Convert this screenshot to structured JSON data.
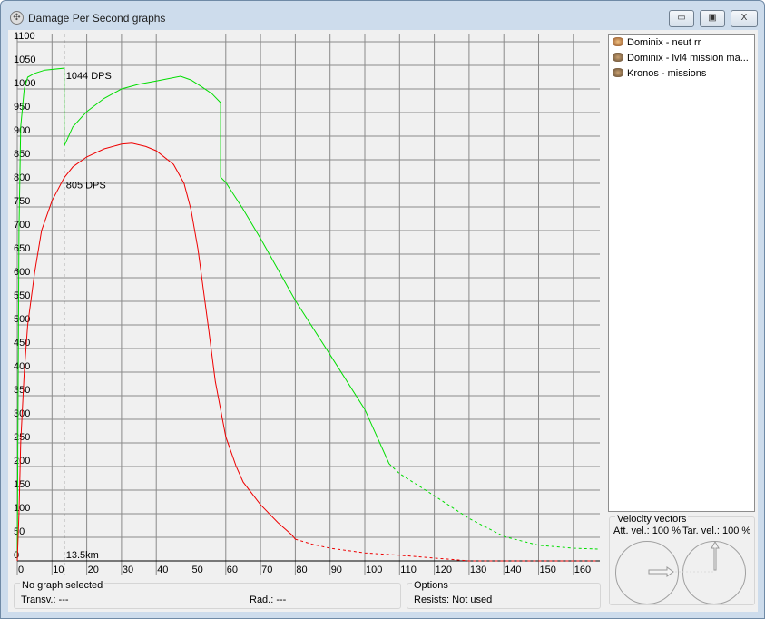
{
  "window": {
    "title": "Damage Per Second graphs",
    "buttons": {
      "minimize": "▭",
      "maximize": "▣",
      "close": "X"
    }
  },
  "legend": {
    "items": [
      {
        "label": "Dominix - neut rr",
        "color": "#ff0000"
      },
      {
        "label": "Dominix - lvl4 mission ma...",
        "color": "#00dd00"
      },
      {
        "label": "Kronos - missions",
        "color": "#0000ff"
      }
    ]
  },
  "status": {
    "title": "No graph selected",
    "transv": "Transv.: ---",
    "rad": "Rad.: ---"
  },
  "options": {
    "title": "Options",
    "resists": "Resists: Not used"
  },
  "velocity": {
    "title": "Velocity vectors",
    "att": "Att. vel.: 100 %",
    "tar": "Tar. vel.: 100 %"
  },
  "chart_data": {
    "type": "line",
    "title": "",
    "xlabel": "",
    "ylabel": "",
    "xlim": [
      0,
      167.5
    ],
    "ylim": [
      0,
      1100
    ],
    "grid": true,
    "xticks": [
      0,
      10,
      20,
      30,
      40,
      50,
      60,
      70,
      80,
      90,
      100,
      110,
      120,
      130,
      140,
      150,
      160
    ],
    "yticks": [
      0,
      50,
      100,
      150,
      200,
      250,
      300,
      350,
      400,
      450,
      500,
      550,
      600,
      650,
      700,
      750,
      800,
      850,
      900,
      950,
      1000,
      1050,
      1100
    ],
    "marker": {
      "x": 13.5,
      "label": "13.5km"
    },
    "annotations": [
      {
        "text": "1044 DPS",
        "x": 13.5,
        "y": 1044
      },
      {
        "text": "805 DPS",
        "x": 13.5,
        "y": 805
      }
    ],
    "series": [
      {
        "name": "Dominix - lvl4 mission ma...",
        "color": "#00dd00",
        "solid_until": 107,
        "points": [
          [
            0,
            0
          ],
          [
            0.5,
            700
          ],
          [
            1,
            920
          ],
          [
            2,
            1000
          ],
          [
            3,
            1025
          ],
          [
            5,
            1033
          ],
          [
            8,
            1040
          ],
          [
            13.5,
            1044
          ],
          [
            13.5,
            879
          ],
          [
            16,
            920
          ],
          [
            20,
            952
          ],
          [
            25,
            980
          ],
          [
            30,
            1000
          ],
          [
            35,
            1010
          ],
          [
            40,
            1017
          ],
          [
            47,
            1027
          ],
          [
            50,
            1019
          ],
          [
            53,
            1005
          ],
          [
            56,
            990
          ],
          [
            58.5,
            971
          ],
          [
            58.5,
            813
          ],
          [
            60,
            802
          ],
          [
            65,
            745
          ],
          [
            70,
            683
          ],
          [
            80,
            552
          ],
          [
            90,
            437
          ],
          [
            100,
            321
          ],
          [
            107,
            206
          ],
          [
            110,
            185
          ],
          [
            120,
            138
          ],
          [
            130,
            90
          ],
          [
            140,
            52
          ],
          [
            150,
            33
          ],
          [
            160,
            27
          ],
          [
            167,
            25
          ]
        ]
      },
      {
        "name": "Dominix - neut rr",
        "color": "#ee0000",
        "solid_until": 80,
        "points": [
          [
            0,
            0
          ],
          [
            0.5,
            100
          ],
          [
            1,
            250
          ],
          [
            2,
            400
          ],
          [
            3,
            500
          ],
          [
            5,
            610
          ],
          [
            7,
            700
          ],
          [
            10,
            763
          ],
          [
            13.5,
            812
          ],
          [
            16,
            835
          ],
          [
            20,
            856
          ],
          [
            25,
            873
          ],
          [
            30,
            883
          ],
          [
            33,
            885
          ],
          [
            37,
            878
          ],
          [
            40,
            869
          ],
          [
            45,
            840
          ],
          [
            48,
            800
          ],
          [
            50,
            744
          ],
          [
            52,
            660
          ],
          [
            55,
            494
          ],
          [
            57,
            380
          ],
          [
            60,
            263
          ],
          [
            63,
            200
          ],
          [
            65,
            167
          ],
          [
            70,
            119
          ],
          [
            75,
            81
          ],
          [
            79,
            55
          ],
          [
            80,
            46
          ],
          [
            85,
            35
          ],
          [
            90,
            27
          ],
          [
            100,
            17
          ],
          [
            110,
            12
          ],
          [
            120,
            6
          ],
          [
            125,
            3
          ],
          [
            130,
            0
          ],
          [
            167,
            0
          ]
        ]
      }
    ]
  }
}
